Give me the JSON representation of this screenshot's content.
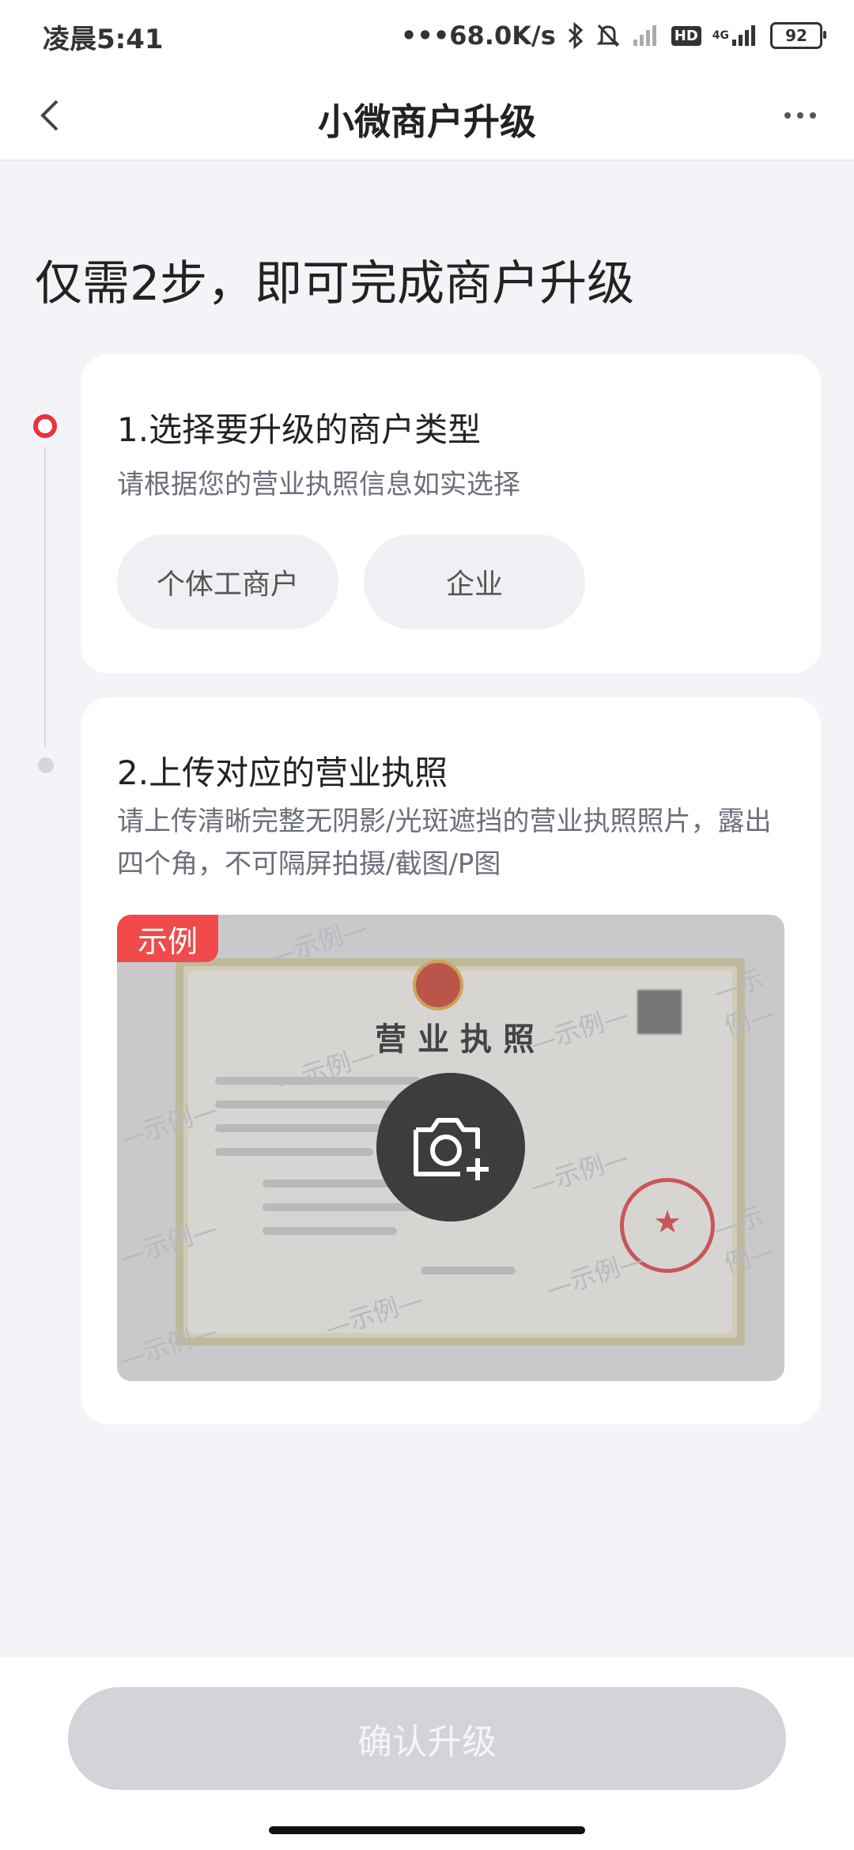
{
  "status_bar": {
    "time": "凌晨5:41",
    "network_speed": "68.0K/s",
    "hd_label": "HD",
    "signal_label": "4G",
    "battery": "92"
  },
  "navbar": {
    "title": "小微商户升级"
  },
  "headline": "仅需2步，即可完成商户升级",
  "step1": {
    "title": "1.选择要升级的商户类型",
    "description": "请根据您的营业执照信息如实选择",
    "options": [
      "个体工商户",
      "企业"
    ]
  },
  "step2": {
    "title": "2.上传对应的营业执照",
    "description": "请上传清晰完整无阴影/光斑遮挡的营业执照照片，露出四个角，不可隔屏拍摄/截图/P图",
    "sample_tag": "示例",
    "license_title": "营业执照",
    "watermark_text": "—示例—"
  },
  "footer": {
    "confirm_label": "确认升级"
  },
  "colors": {
    "accent_red": "#e8333b",
    "sample_tag_bg": "#f04a4a",
    "disabled_button": "#d2d4d9"
  }
}
